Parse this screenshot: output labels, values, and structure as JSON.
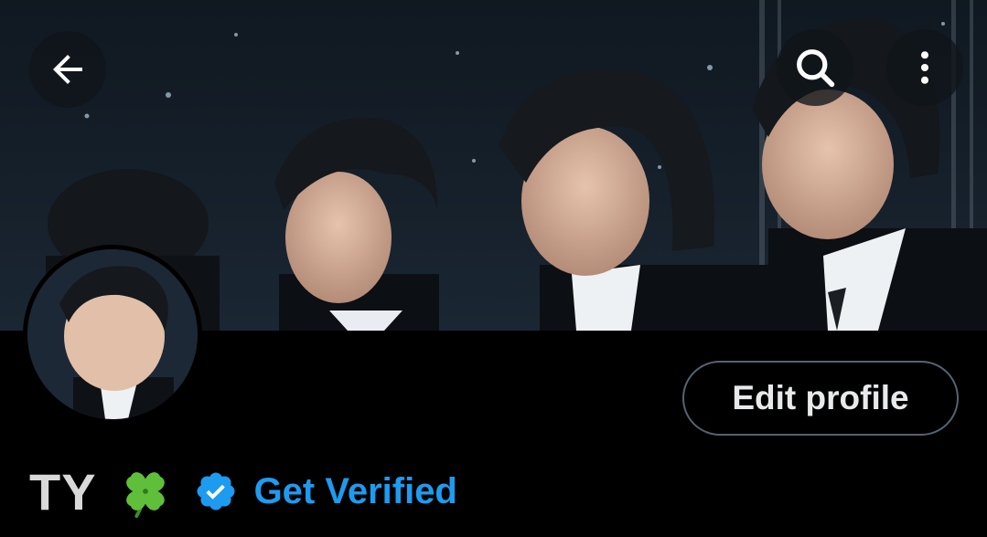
{
  "header": {
    "back_icon": "arrow-left-icon",
    "search_icon": "search-icon",
    "more_icon": "more-vertical-icon"
  },
  "profile": {
    "name": "TY",
    "emoji": "four-leaf-clover",
    "verified_icon": "verified-badge-icon",
    "get_verified_label": "Get Verified",
    "edit_profile_label": "Edit profile"
  },
  "colors": {
    "accent": "#1d9bf0",
    "background": "#000000",
    "text": "#e7e9ea",
    "border": "#536471"
  }
}
